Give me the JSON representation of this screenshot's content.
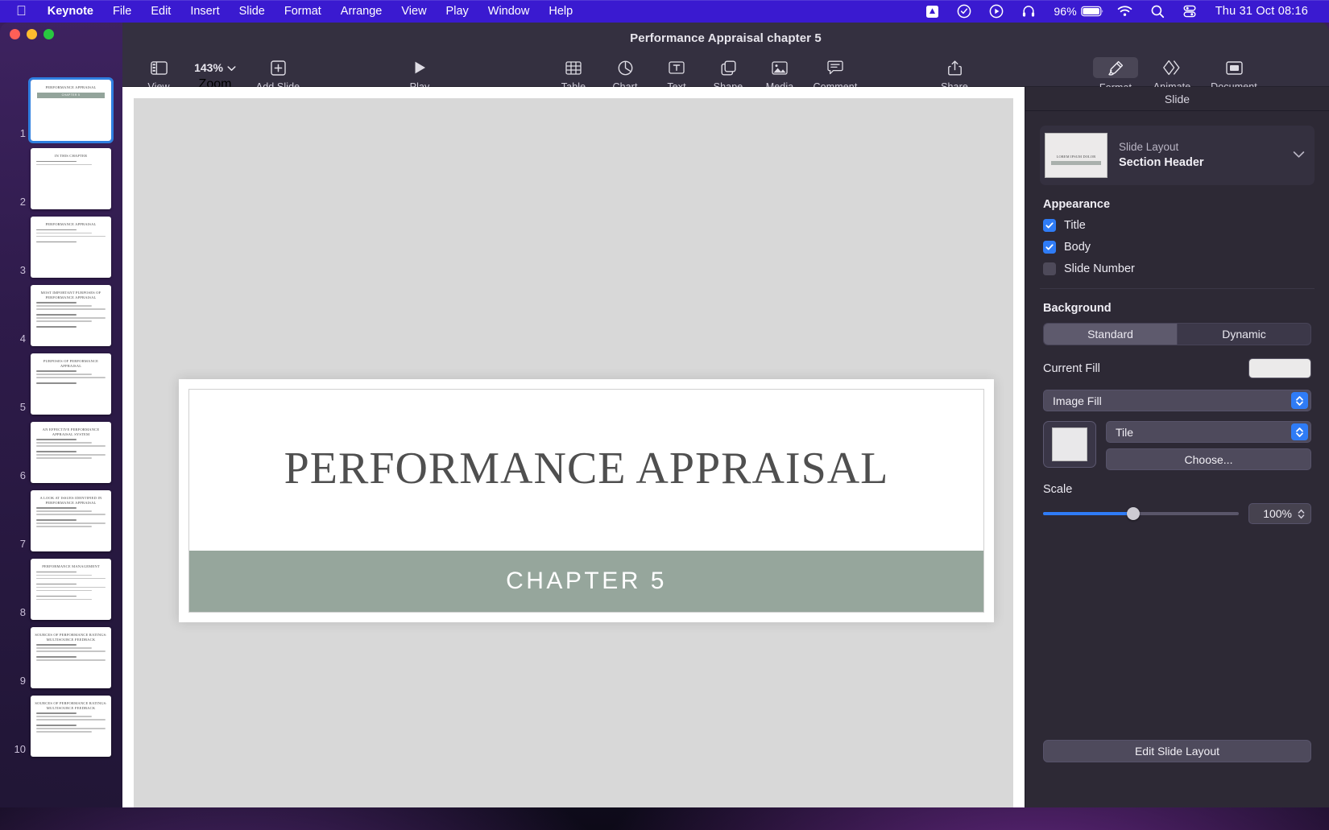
{
  "menubar": {
    "apple_icon": "apple-logo-icon",
    "items": [
      {
        "label": "Keynote",
        "bold": true
      },
      {
        "label": "File",
        "bold": false
      },
      {
        "label": "Edit",
        "bold": false
      },
      {
        "label": "Insert",
        "bold": false
      },
      {
        "label": "Slide",
        "bold": false
      },
      {
        "label": "Format",
        "bold": false
      },
      {
        "label": "Arrange",
        "bold": false
      },
      {
        "label": "View",
        "bold": false
      },
      {
        "label": "Play",
        "bold": false
      },
      {
        "label": "Window",
        "bold": false
      },
      {
        "label": "Help",
        "bold": false
      }
    ],
    "status": {
      "battery_percent": "96%",
      "datetime": "Thu 31 Oct  08:16",
      "icons": [
        "dropbox-icon",
        "checkmark-circle-icon",
        "play-circle-icon",
        "headphones-icon",
        "battery-icon",
        "wifi-icon",
        "search-icon",
        "control-center-icon"
      ]
    },
    "background_color": "#3a1ad0"
  },
  "window": {
    "title": "Performance Appraisal chapter 5",
    "traffic_lights": [
      "close",
      "minimize",
      "zoom"
    ]
  },
  "toolbar": {
    "left": [
      {
        "label": "View",
        "icon": "sidebar-view-icon"
      },
      {
        "label": "Zoom",
        "icon": "chevron-down-icon",
        "value": "143%"
      },
      {
        "label": "Add Slide",
        "icon": "plus-square-icon"
      }
    ],
    "play": {
      "label": "Play",
      "icon": "play-triangle-icon"
    },
    "insert": [
      {
        "label": "Table",
        "icon": "table-icon"
      },
      {
        "label": "Chart",
        "icon": "pie-chart-icon"
      },
      {
        "label": "Text",
        "icon": "text-box-icon"
      },
      {
        "label": "Shape",
        "icon": "shapes-icon"
      },
      {
        "label": "Media",
        "icon": "photo-icon"
      },
      {
        "label": "Comment",
        "icon": "comment-bubble-icon"
      }
    ],
    "share": {
      "label": "Share",
      "icon": "share-up-arrow-icon"
    },
    "right": [
      {
        "label": "Format",
        "icon": "paintbrush-icon",
        "active": true
      },
      {
        "label": "Animate",
        "icon": "animate-diamonds-icon",
        "active": false
      },
      {
        "label": "Document",
        "icon": "document-icon",
        "active": false
      }
    ]
  },
  "slide_navigator": {
    "slides": [
      {
        "number": "1",
        "selected": true,
        "kind": "section",
        "title": "PERFORMANCE APPRAISAL",
        "band": "CHAPTER 5"
      },
      {
        "number": "2",
        "selected": false,
        "kind": "bullets",
        "title": "IN THIS CHAPTER",
        "lines": 2
      },
      {
        "number": "3",
        "selected": false,
        "kind": "bullets",
        "title": "PERFORMANCE APPRAISAL",
        "lines": 4
      },
      {
        "number": "4",
        "selected": false,
        "kind": "bullets",
        "title": "MOST IMPORTANT PURPOSES OF PERFORMANCE APPRAISAL",
        "lines": 7
      },
      {
        "number": "5",
        "selected": false,
        "kind": "bullets",
        "title": "PURPOSES OF PERFORMANCE APPRAISAL",
        "lines": 4
      },
      {
        "number": "6",
        "selected": false,
        "kind": "bullets",
        "title": "AN EFFECTIVE PERFORMANCE APPRAISAL SYSTEM",
        "lines": 6
      },
      {
        "number": "7",
        "selected": false,
        "kind": "bullets",
        "title": "A LOOK AT ISSUES IDENTIFIED IN PERFORMANCE APPRAISAL",
        "lines": 6
      },
      {
        "number": "8",
        "selected": false,
        "kind": "bullets",
        "title": "PERFORMANCE MANAGEMENT",
        "lines": 8
      },
      {
        "number": "9",
        "selected": false,
        "kind": "bullets",
        "title": "SOURCES OF PERFORMANCE RATINGS: MULTISOURCE FEEDBACK",
        "lines": 5
      },
      {
        "number": "10",
        "selected": false,
        "kind": "bullets",
        "title": "SOURCES OF PERFORMANCE RATINGS: MULTISOURCE FEEDBACK",
        "lines": 6
      }
    ]
  },
  "canvas": {
    "slide": {
      "title": "PERFORMANCE APPRAISAL",
      "subtitle": "CHAPTER 5",
      "band_color": "#96a69c",
      "title_color": "#4f4f4f",
      "background_color": "#ffffff"
    }
  },
  "inspector": {
    "header": "Slide",
    "layout": {
      "label": "Slide Layout",
      "value": "Section Header",
      "thumb_title": "LOREM IPSUM DOLOR"
    },
    "appearance": {
      "title": "Appearance",
      "options": [
        {
          "label": "Title",
          "checked": true
        },
        {
          "label": "Body",
          "checked": true
        },
        {
          "label": "Slide Number",
          "checked": false
        }
      ]
    },
    "background": {
      "title": "Background",
      "segments": [
        {
          "label": "Standard",
          "active": true
        },
        {
          "label": "Dynamic",
          "active": false
        }
      ],
      "current_fill_label": "Current Fill",
      "current_fill_color": "#ebeaea",
      "fill_type": "Image Fill",
      "image_mode": "Tile",
      "choose_button": "Choose...",
      "scale_label": "Scale",
      "scale_value": "100%"
    },
    "edit_layout_button": "Edit Slide Layout",
    "accent_color": "#2f7cf6"
  }
}
